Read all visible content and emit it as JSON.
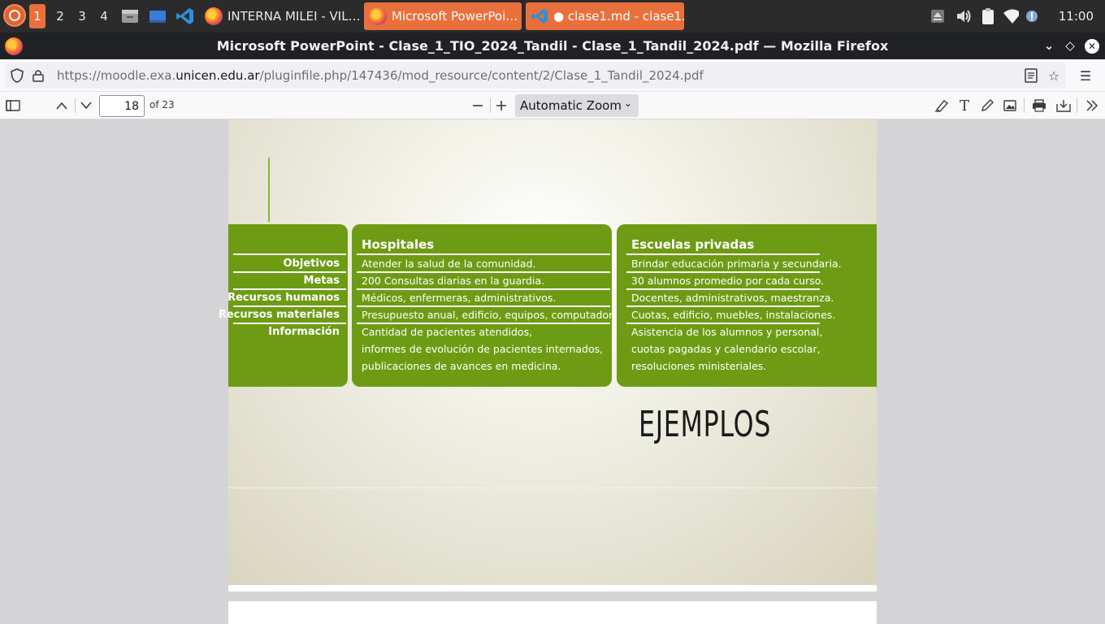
{
  "taskbar": {
    "workspaces": [
      "1",
      "2",
      "3",
      "4"
    ],
    "active_workspace": "1",
    "tasks": [
      {
        "label": "INTERNA MILEI - VIL…",
        "icon": "firefox-icon",
        "highlighted": false
      },
      {
        "label": "Microsoft PowerPoi…",
        "icon": "firefox-icon",
        "highlighted": true
      },
      {
        "label": "● clase1.md - clase1…",
        "icon": "vscode-icon",
        "highlighted": true
      }
    ],
    "clock": "11:00",
    "accent_color": "#e9703c"
  },
  "window": {
    "title": "Microsoft PowerPoint - Clase_1_TIO_2024_Tandil - Clase_1_Tandil_2024.pdf — Mozilla Firefox"
  },
  "urlbar": {
    "prefix": "https://moodle.exa.",
    "domain": "unicen.edu.ar",
    "path": "/pluginfile.php/147436/mod_resource/content/2/Clase_1_Tandil_2024.pdf"
  },
  "pdf_toolbar": {
    "page_number": "18",
    "page_count": "of 23",
    "zoom": "Automatic Zoom"
  },
  "slide": {
    "title": "EJEMPLOS",
    "green": "#6d9c14",
    "row_labels": [
      "Objetivos",
      "Metas",
      "Recursos humanos",
      "Recursos materiales",
      "Información"
    ],
    "hospitales": {
      "header": "Hospitales",
      "rows": [
        "Atender la salud de la comunidad.",
        "200 Consultas diarias en la guardia.",
        "Médicos, enfermeras, administrativos.",
        "Presupuesto anual, edificio, equipos, computadoras.",
        "Cantidad de pacientes atendidos,",
        "informes de evolución de pacientes internados,",
        "publicaciones de avances en medicina."
      ]
    },
    "escuelas": {
      "header": "Escuelas privadas",
      "rows": [
        "Brindar educación primaria y secundaria.",
        "30 alumnos promedio por cada curso.",
        "Docentes, administrativos, maestranza.",
        "Cuotas, edificio, muebles, instalaciones.",
        "Asistencia de los alumnos y personal,",
        "cuotas pagadas y calendario escolar,",
        "resoluciones ministeriales."
      ]
    }
  }
}
